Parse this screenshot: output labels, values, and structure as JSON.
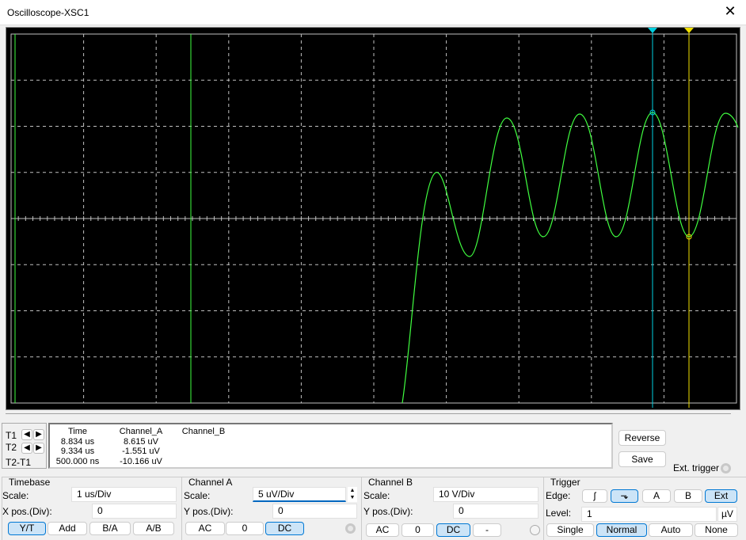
{
  "window": {
    "title": "Oscilloscope-XSC1",
    "close_icon": "close-icon"
  },
  "cursors": {
    "t1_color": "#00d0e0",
    "t2_color": "#f0e000"
  },
  "trace": {
    "color": "#40ff40",
    "grid_color": "#c0c0c0"
  },
  "readout": {
    "labels": [
      "T1",
      "T2",
      "T2-T1"
    ],
    "headers": [
      "Time",
      "Channel_A",
      "Channel_B"
    ],
    "time": [
      "8.834 us",
      "9.334 us",
      "500.000 ns"
    ],
    "channel_a": [
      "8.615 uV",
      "-1.551 uV",
      "-10.166 uV"
    ]
  },
  "buttons": {
    "reverse": "Reverse",
    "save": "Save",
    "ext_trigger": "Ext. trigger"
  },
  "timebase": {
    "title": "Timebase",
    "scale_label": "Scale:",
    "scale": "1 us/Div",
    "xpos_label": "X pos.(Div):",
    "xpos": "0",
    "modes": [
      "Y/T",
      "Add",
      "B/A",
      "A/B"
    ]
  },
  "channel_a": {
    "title": "Channel A",
    "scale_label": "Scale:",
    "scale": "5 uV/Div",
    "ypos_label": "Y pos.(Div):",
    "ypos": "0",
    "coupling": [
      "AC",
      "0",
      "DC"
    ]
  },
  "channel_b": {
    "title": "Channel B",
    "scale_label": "Scale:",
    "scale": "10  V/Div",
    "ypos_label": "Y pos.(Div):",
    "ypos": "0",
    "coupling": [
      "AC",
      "0",
      "DC",
      "-"
    ]
  },
  "trigger": {
    "title": "Trigger",
    "edge_label": "Edge:",
    "edges": [
      "ʃ",
      "⬎"
    ],
    "sources": [
      "A",
      "B",
      "Ext"
    ],
    "level_label": "Level:",
    "level": "1",
    "level_unit": "µV",
    "modes": [
      "Single",
      "Normal",
      "Auto",
      "None"
    ]
  }
}
